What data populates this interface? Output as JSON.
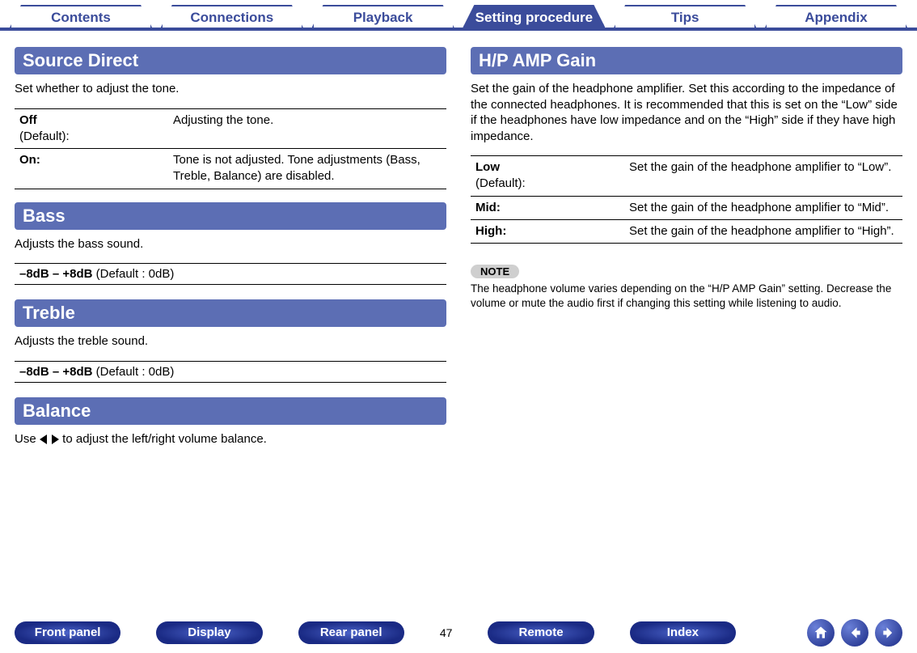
{
  "topTabs": {
    "items": [
      {
        "label": "Contents"
      },
      {
        "label": "Connections"
      },
      {
        "label": "Playback"
      },
      {
        "label": "Setting procedure",
        "active": true
      },
      {
        "label": "Tips"
      },
      {
        "label": "Appendix"
      }
    ]
  },
  "left": {
    "sourceDirect": {
      "title": "Source Direct",
      "desc": "Set whether to adjust the tone.",
      "rows": [
        {
          "kBold": "Off",
          "kRest": "\n(Default):",
          "v": "Adjusting the tone."
        },
        {
          "kBold": "On:",
          "kRest": "",
          "v": "Tone is not adjusted. Tone adjustments (Bass, Treble, Balance) are disabled."
        }
      ]
    },
    "bass": {
      "title": "Bass",
      "desc": "Adjusts the bass sound.",
      "rangeBold": "–8dB – +8dB",
      "rangeRest": " (Default : 0dB)"
    },
    "treble": {
      "title": "Treble",
      "desc": "Adjusts the treble sound.",
      "rangeBold": "–8dB – +8dB",
      "rangeRest": " (Default : 0dB)"
    },
    "balance": {
      "title": "Balance",
      "descPre": "Use ",
      "descPost": " to adjust the left/right volume balance."
    }
  },
  "right": {
    "hpamp": {
      "title": "H/P AMP Gain",
      "desc": "Set the gain of the headphone amplifier. Set this according to the impedance of the connected headphones. It is recommended that this is set on the “Low” side if the headphones have low impedance and on the “High” side if they have high impedance.",
      "rows": [
        {
          "kBold": "Low",
          "kRest": "\n(Default):",
          "v": "Set the gain of the headphone amplifier to “Low”."
        },
        {
          "kBold": "Mid:",
          "kRest": "",
          "v": "Set the gain of the headphone amplifier to “Mid”."
        },
        {
          "kBold": "High:",
          "kRest": "",
          "v": "Set the gain of the headphone amplifier to “High”."
        }
      ],
      "noteLabel": "NOTE",
      "noteText": "The headphone volume varies depending on the “H/P AMP Gain” setting. Decrease the volume or mute the audio first if changing this setting while listening to audio."
    }
  },
  "bottom": {
    "pills": [
      "Front panel",
      "Display",
      "Rear panel",
      "Remote",
      "Index"
    ],
    "page": "47"
  }
}
